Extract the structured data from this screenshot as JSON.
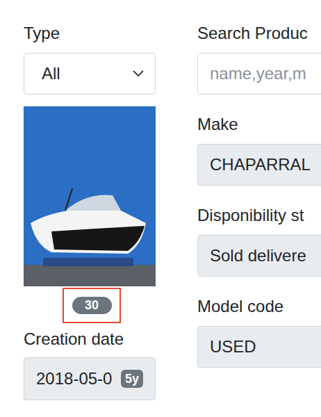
{
  "filters": {
    "type": {
      "label": "Type",
      "value": "All"
    },
    "search": {
      "label": "Search Produc",
      "placeholder": "name,year,m"
    },
    "fields": [
      {
        "label": "Make",
        "value": "CHAPARRAL"
      },
      {
        "label": "Disponibility st",
        "value": "Sold delivere"
      },
      {
        "label": "Model code",
        "value": "USED"
      }
    ]
  },
  "photo": {
    "badge": "30",
    "highlighted": true
  },
  "creation_date": {
    "label": "Creation date",
    "value": "2018-05-0",
    "age_badge": "5y"
  }
}
